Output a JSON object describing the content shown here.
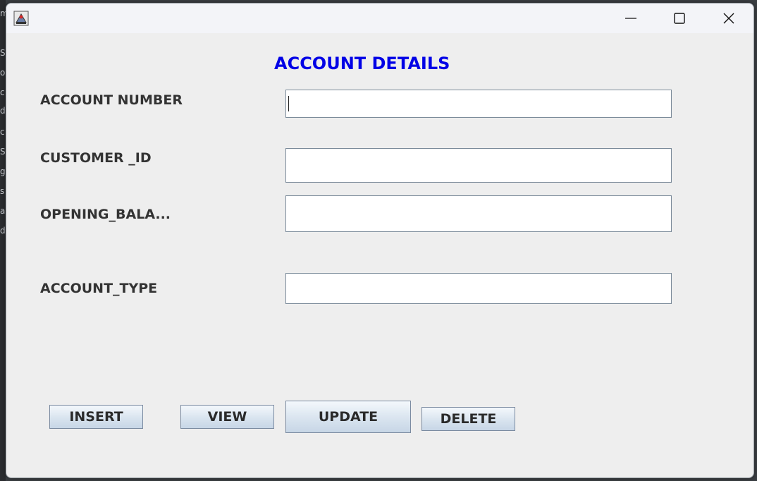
{
  "window": {
    "title_icon": "java-cup-icon",
    "controls": {
      "minimize": "minimize-icon",
      "maximize": "maximize-icon",
      "close": "close-icon"
    }
  },
  "background_glyphs": [
    "m",
    "S",
    "o",
    "c",
    "d",
    "c",
    "S",
    "g",
    "s",
    "a",
    "d"
  ],
  "form": {
    "title": "ACCOUNT DETAILS",
    "fields": [
      {
        "label": "ACCOUNT NUMBER",
        "value": ""
      },
      {
        "label": "CUSTOMER _ID",
        "value": ""
      },
      {
        "label": "OPENING_BALA...",
        "value": ""
      },
      {
        "label": "ACCOUNT_TYPE",
        "value": ""
      }
    ],
    "buttons": {
      "insert": "INSERT",
      "view": "VIEW",
      "update": "UPDATE",
      "delete": "DELETE"
    }
  },
  "colors": {
    "title": "#0000e6",
    "label": "#333333",
    "window_bg": "#eeeeee"
  }
}
